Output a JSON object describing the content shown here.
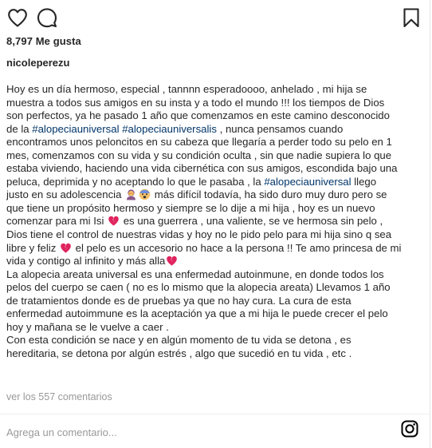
{
  "post": {
    "likes": "8,797 Me gusta",
    "author": "nicoleperezu",
    "caption_lines": [
      [
        {
          "t": "Hoy es un día hermoso, especial , tannnn esperadoooo, anhelado , mi hija se"
        }
      ],
      [
        {
          "t": "muestra a todos sus amigos en su insta y a todo el mundo !!! los tiempos de Dios"
        }
      ],
      [
        {
          "t": "son perfectos, ya he pasado 1 año que comenzamos en este camino desconocido"
        }
      ],
      [
        {
          "t": "de la "
        },
        {
          "t": "#alopeciauniversal",
          "k": "tag"
        },
        {
          "t": " "
        },
        {
          "t": "#alopeciauniversalis",
          "k": "tag"
        },
        {
          "t": " , nunca pensamos cuando"
        }
      ],
      [
        {
          "t": "encontramos unos peloncitos en su cabeza que llegaría a perder todo su pelo en 1"
        }
      ],
      [
        {
          "t": "mes, comenzamos con su vida y su condición oculta , sin que nadie supiera lo que"
        }
      ],
      [
        {
          "t": "estaba viviendo, haciendo una vida cibernética con sus amigos, escondida bajo una"
        }
      ],
      [
        {
          "t": "peluca, deprimida y no aceptando lo que le pasaba , la "
        },
        {
          "t": "#alopeciauniversal",
          "k": "tag"
        },
        {
          "t": " llego"
        }
      ],
      [
        {
          "t": "justo en su adolescencia "
        },
        {
          "e": "woman-facepalming"
        },
        {
          "e": "fearful-face"
        },
        {
          "t": " más difícil todavía, ha sido duro muy duro pero se"
        }
      ],
      [
        {
          "t": "que tiene un propósito hermoso y siempre se lo dije a mi hija , hoy es un nuevo"
        }
      ],
      [
        {
          "t": "comenzar para mi Isi "
        },
        {
          "e": "broken-heart"
        },
        {
          "t": " es una guerrera , una valiente, se ve hermosa sin pelo ,"
        }
      ],
      [
        {
          "t": "Dios tiene el control de nuestras vidas y hoy no le pido pelo para mi hija sino q sea"
        }
      ],
      [
        {
          "t": "libre y feliz "
        },
        {
          "e": "broken-heart"
        },
        {
          "t": " el pelo es un accesorio no hace a la persona !! Te amo princesa de mi"
        }
      ],
      [
        {
          "t": "vida y contigo al infinito y más alla"
        },
        {
          "e": "broken-heart"
        }
      ],
      [
        {
          "t": "La alopecia areata universal es una enfermedad autoinmune, en donde todos los"
        }
      ],
      [
        {
          "t": "pelos del cuerpo se caen ( no es lo mismo que la alopecia areata) Llevamos 1 año"
        }
      ],
      [
        {
          "t": "de tratamientos donde es de pruebas ya que no hay cura. La cura de esta"
        }
      ],
      [
        {
          "t": "enfermedad autoimmune es la aceptación ya que a mi hija le puede crecer el pelo"
        }
      ],
      [
        {
          "t": "hoy y mañana se le vuelve a caer ."
        }
      ],
      [
        {
          "t": "Con esta condición se nace y en algún momento de tu vida se detona , es"
        }
      ],
      [
        {
          "t": "hereditaria, se detona por algún estrés , algo que sucedió en tu vida , etc ."
        }
      ]
    ],
    "view_comments": "ver los 557 comentarios",
    "comment_placeholder": "Agrega un comentario..."
  },
  "icons": {
    "like": "heart-icon",
    "comment": "comment-bubble-icon",
    "save": "bookmark-icon",
    "brand": "instagram-icon"
  },
  "colors": {
    "text": "#262626",
    "hashtag": "#003569",
    "muted": "#999999",
    "emoji_heart": "#e0245e",
    "emoji_skin": "#f5c16c",
    "emoji_hair": "#8a5a8c"
  }
}
